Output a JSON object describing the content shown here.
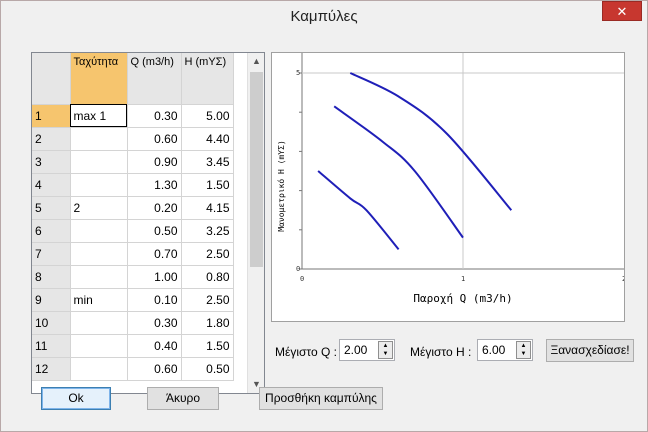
{
  "window": {
    "title": "Καμπύλες",
    "close_glyph": "✕"
  },
  "grid": {
    "headers": [
      "Ταχύτητα",
      "Q (m3/h)",
      "H (mΥΣ)"
    ],
    "rows": [
      {
        "n": "1",
        "speed": "max 1",
        "q": "0.30",
        "h": "5.00"
      },
      {
        "n": "2",
        "speed": "",
        "q": "0.60",
        "h": "4.40"
      },
      {
        "n": "3",
        "speed": "",
        "q": "0.90",
        "h": "3.45"
      },
      {
        "n": "4",
        "speed": "",
        "q": "1.30",
        "h": "1.50"
      },
      {
        "n": "5",
        "speed": "2",
        "q": "0.20",
        "h": "4.15"
      },
      {
        "n": "6",
        "speed": "",
        "q": "0.50",
        "h": "3.25"
      },
      {
        "n": "7",
        "speed": "",
        "q": "0.70",
        "h": "2.50"
      },
      {
        "n": "8",
        "speed": "",
        "q": "1.00",
        "h": "0.80"
      },
      {
        "n": "9",
        "speed": "min",
        "q": "0.10",
        "h": "2.50"
      },
      {
        "n": "10",
        "speed": "",
        "q": "0.30",
        "h": "1.80"
      },
      {
        "n": "11",
        "speed": "",
        "q": "0.40",
        "h": "1.50"
      },
      {
        "n": "12",
        "speed": "",
        "q": "0.60",
        "h": "0.50"
      }
    ],
    "scroll_up_icon": "▲",
    "scroll_down_icon": "▼"
  },
  "chart": {
    "xlabel": "Παροχή Q (m3/h)",
    "ylabel": "Μανομετρικό H (mΥΣ)",
    "x_ticks": [
      "0",
      "1",
      "2"
    ],
    "y_ticks": [
      "0",
      "5"
    ],
    "xlim": [
      0,
      2
    ],
    "ylim": [
      0,
      5
    ],
    "grid": true,
    "curve_color": "#1f1fb8"
  },
  "controls": {
    "max_q_label": "Μέγιστο Q :",
    "max_q_value": "2.00",
    "max_h_label": "Μέγιστο Η :",
    "max_h_value": "6.00",
    "redraw_label": "Ξανασχεδίασε!",
    "spin_up": "▲",
    "spin_down": "▼"
  },
  "buttons": {
    "ok": "Ok",
    "cancel": "Άκυρο",
    "add_curve": "Προσθήκη καμπύλης"
  },
  "chart_data": {
    "type": "line",
    "title": "",
    "xlabel": "Παροχή Q (m3/h)",
    "ylabel": "Μανομετρικό H (mΥΣ)",
    "xlim": [
      0,
      2
    ],
    "ylim": [
      0,
      5
    ],
    "series": [
      {
        "x": [
          0.3,
          0.6,
          0.9,
          1.3
        ],
        "y": [
          5.0,
          4.4,
          3.45,
          1.5
        ]
      },
      {
        "x": [
          0.2,
          0.5,
          0.7,
          1.0
        ],
        "y": [
          4.15,
          3.25,
          2.5,
          0.8
        ]
      },
      {
        "x": [
          0.1,
          0.3,
          0.4,
          0.6
        ],
        "y": [
          2.5,
          1.8,
          1.5,
          0.5
        ]
      }
    ]
  }
}
